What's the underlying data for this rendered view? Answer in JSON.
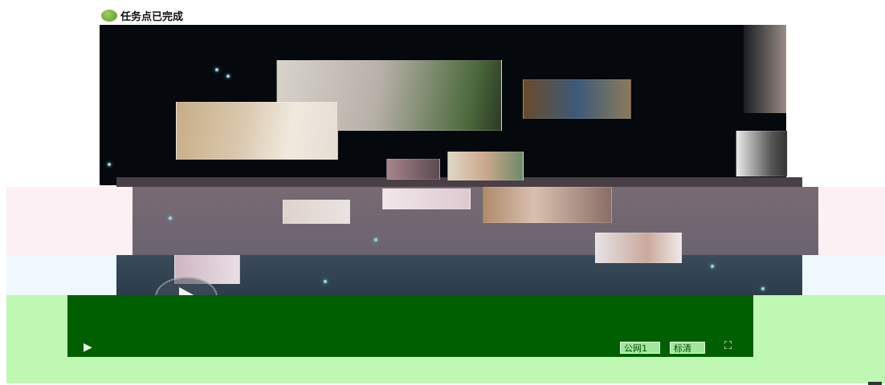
{
  "status": {
    "text": "任务点已完成",
    "dot_color": "#6fb03a"
  },
  "player": {
    "icons": {
      "play": "▶",
      "fullscreen": "⛶",
      "big_play": "play-circle-icon"
    },
    "line_label": "公网1",
    "quality_label": "标清",
    "control_bar_color": "#005f00",
    "page_tint_color": "#bff8b2"
  }
}
